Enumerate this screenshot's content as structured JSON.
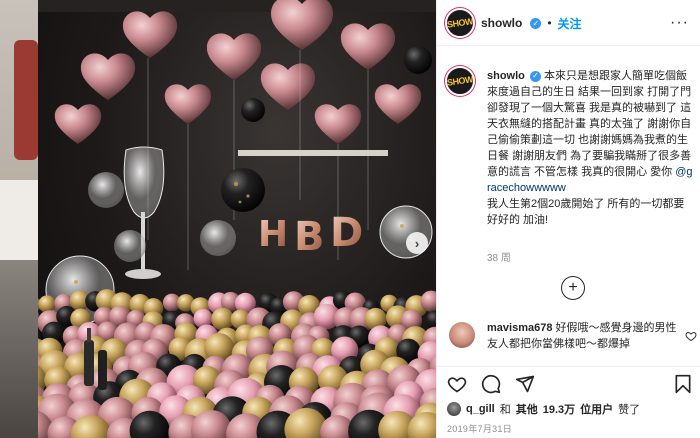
{
  "post": {
    "username": "showlo",
    "verified_mark": "✓",
    "dot": "•",
    "follow_label": "关注",
    "more_label": "···",
    "avatar_logo": "SHOW"
  },
  "caption": {
    "username": "showlo",
    "text": "本來只是想跟家人簡單吃個飯來度過自己的生日 結果一回到家 打開了門 卻發現了一個大驚喜 我是真的被嚇到了 這天衣無縫的搭配計畫 真的太強了 謝謝你自己偷偷策劃這一切 也謝謝媽媽為我煮的生日餐 謝謝朋友們 為了要騙我瞞掰了很多善意的謊言 不管怎樣 我真的很開心 愛你",
    "mention": "@gracechowwwww",
    "text2": "我人生第2個20歲開始了 所有的一切都要好好的 加油!",
    "time_ago": "38 周"
  },
  "load_more_label": "+",
  "comment": {
    "username": "mavisma678",
    "text": "好假哦～感覺身邊的男性友人都把你當佛樣吧～都爆掉"
  },
  "likes": {
    "liker": "q_gill",
    "text_and": "和",
    "text_others": "其他",
    "count": "19.3万",
    "text_users": "位用户",
    "text_liked": "赞了"
  },
  "date": "2019年7月31日",
  "icons": [
    "heart-icon",
    "comment-icon",
    "share-icon",
    "bookmark-icon",
    "more-icon",
    "chevron-right-icon",
    "add-circle-icon",
    "verified-icon"
  ],
  "photo_balloon_letters": [
    "H",
    "B",
    "D"
  ],
  "colors": {
    "accent_blue": "#0095f6",
    "verified_blue": "#3897f0",
    "muted": "#8e8e8e",
    "rose_gold": "#d9a3a8",
    "gold": "#c9a24a"
  }
}
